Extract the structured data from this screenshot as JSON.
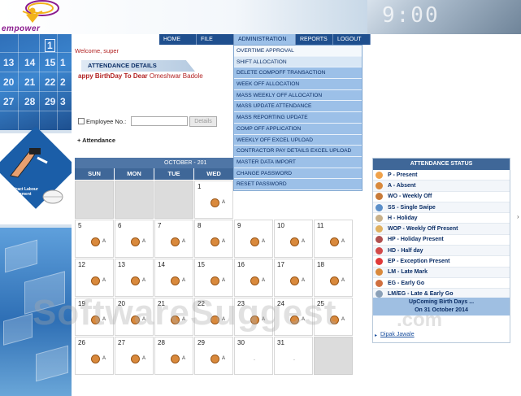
{
  "brand": {
    "name": "empower",
    "clock": "9:00"
  },
  "nav": {
    "items": [
      "HOME",
      "FILE",
      "ADMINISTRATION",
      "REPORTS",
      "LOGOUT"
    ],
    "active": "ADMINISTRATION"
  },
  "welcome": "Welcome, super",
  "section_title": "ATTENDANCE DETAILS",
  "birthday": {
    "text": "appy BirthDay To Dear",
    "name": "Omeshwar Badole"
  },
  "employee": {
    "label": "Employee No.:",
    "value": "",
    "details_label": "Details"
  },
  "attendance_link": "+ Attendance",
  "left": {
    "cls_label": "Contract Labour Management"
  },
  "calendar": {
    "month": "OCTOBER - 201",
    "days": [
      "SUN",
      "MON",
      "TUE",
      "WED"
    ],
    "weeks": [
      [
        {
          "d": "",
          "s": ""
        },
        {
          "d": "",
          "s": ""
        },
        {
          "d": "",
          "s": ""
        },
        {
          "d": "1",
          "s": "A"
        }
      ],
      [
        {
          "d": "5",
          "s": "A"
        },
        {
          "d": "6",
          "s": "A"
        },
        {
          "d": "7",
          "s": "A"
        },
        {
          "d": "8",
          "s": "A"
        },
        {
          "d": "9",
          "s": "A"
        },
        {
          "d": "10",
          "s": "A"
        },
        {
          "d": "11",
          "s": "A"
        }
      ],
      [
        {
          "d": "12",
          "s": "A"
        },
        {
          "d": "13",
          "s": "A"
        },
        {
          "d": "14",
          "s": "A"
        },
        {
          "d": "15",
          "s": "A"
        },
        {
          "d": "16",
          "s": "A"
        },
        {
          "d": "17",
          "s": "A"
        },
        {
          "d": "18",
          "s": "A"
        }
      ],
      [
        {
          "d": "19",
          "s": "A"
        },
        {
          "d": "20",
          "s": "A"
        },
        {
          "d": "21",
          "s": "A"
        },
        {
          "d": "22",
          "s": "A"
        },
        {
          "d": "23",
          "s": "A"
        },
        {
          "d": "24",
          "s": "A"
        },
        {
          "d": "25",
          "s": "A"
        }
      ],
      [
        {
          "d": "26",
          "s": "A"
        },
        {
          "d": "27",
          "s": "A"
        },
        {
          "d": "28",
          "s": "A"
        },
        {
          "d": "29",
          "s": "A"
        },
        {
          "d": "30",
          "s": "."
        },
        {
          "d": "31",
          "s": "."
        },
        {
          "d": "",
          "s": ""
        }
      ]
    ]
  },
  "dropdown": {
    "items": [
      "OVERTIME APPROVAL",
      "SHIFT ALLOCATION",
      "DELETE COMPOFF TRANSACTION",
      "WEEK OFF ALLOCATION",
      "MASS WEEKLY OFF ALLOCATION",
      "MASS UPDATE ATTENDANCE",
      "MASS REPORTING UPDATE",
      "COMP OFF APPLICATION",
      "WEEKLY OFF EXCEL UPLOAD",
      "CONTRACTOR PAY DETAILS EXCEL UPLOAD",
      "MASTER DATA IMPORT",
      "CHANGE PASSWORD",
      "RESET PASSWORD"
    ]
  },
  "status": {
    "title": "ATTENDANCE STATUS",
    "items": [
      {
        "label": "P - Present",
        "color": "#f0a24a"
      },
      {
        "label": "A - Absent",
        "color": "#d9893c"
      },
      {
        "label": "WO - Weekly Off",
        "color": "#c87b3a"
      },
      {
        "label": "SS - Single Swipe",
        "color": "#5b8fc9"
      },
      {
        "label": "H - Holiday",
        "color": "#c9b18a"
      },
      {
        "label": "WOP - Weekly Off Present",
        "color": "#e0b060"
      },
      {
        "label": "HP - Holiday Present",
        "color": "#b05050"
      },
      {
        "label": "HD - Half day",
        "color": "#d24a4a"
      },
      {
        "label": "EP - Exception Present",
        "color": "#e03a3a"
      },
      {
        "label": "LM - Late Mark",
        "color": "#d9893c"
      },
      {
        "label": "EG - Early Go",
        "color": "#d07040"
      },
      {
        "label": "LM/EG - Late & Early Go",
        "color": "#8aa0b8"
      }
    ],
    "upcoming_line1": "UpComing Birth Days ...",
    "upcoming_line2": "On 31 October 2014",
    "person": "Dipak Jawale"
  },
  "watermark": {
    "main": "SoftwareSuggest",
    "suffix": ".com"
  }
}
